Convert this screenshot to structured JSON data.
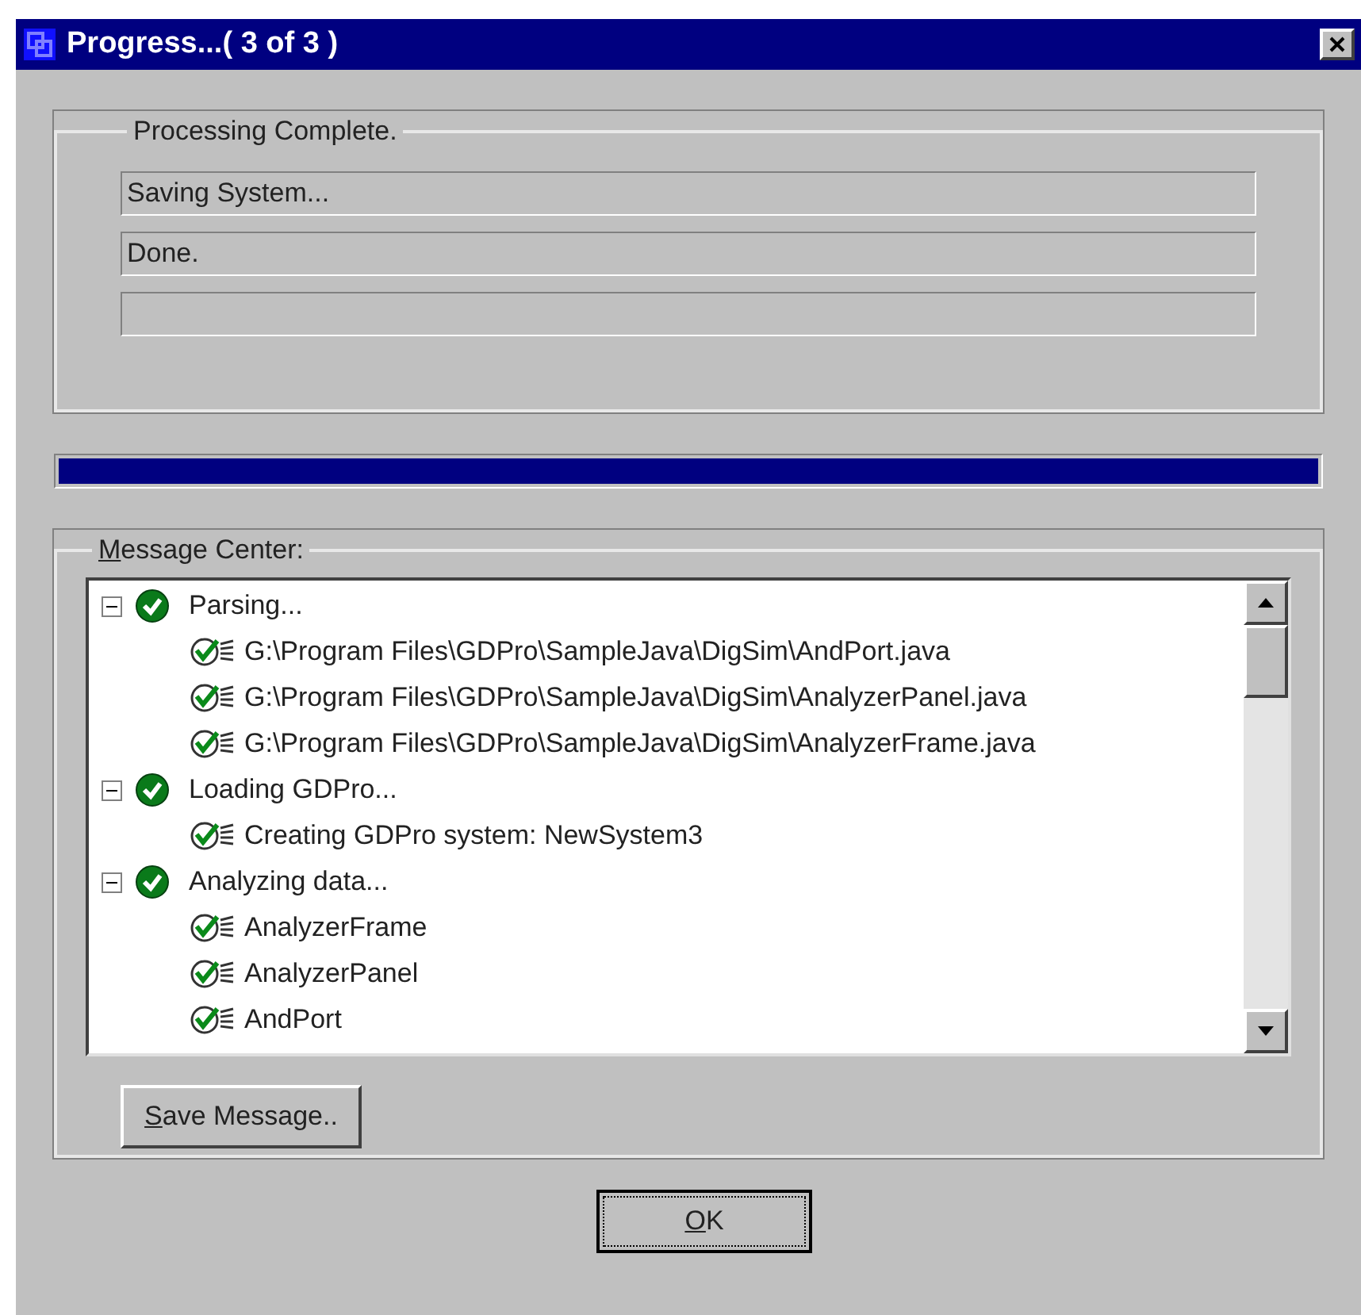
{
  "window": {
    "title": "Progress...( 3 of 3 )"
  },
  "processing": {
    "label": "Processing Complete.",
    "fields": [
      {
        "value": "Saving System..."
      },
      {
        "value": "Done."
      }
    ]
  },
  "progress": {
    "level": 1
  },
  "message_center": {
    "label": "Message Center:",
    "tree": [
      {
        "label": "Parsing...",
        "expanded": true,
        "children": [
          {
            "label": "G:\\Program Files\\GDPro\\SampleJava\\DigSim\\AndPort.java"
          },
          {
            "label": "G:\\Program Files\\GDPro\\SampleJava\\DigSim\\AnalyzerPanel.java"
          },
          {
            "label": "G:\\Program Files\\GDPro\\SampleJava\\DigSim\\AnalyzerFrame.java"
          }
        ]
      },
      {
        "label": "Loading GDPro...",
        "expanded": true,
        "children": [
          {
            "label": "Creating GDPro system: NewSystem3"
          }
        ]
      },
      {
        "label": "Analyzing data...",
        "expanded": true,
        "children": [
          {
            "label": "AnalyzerFrame"
          },
          {
            "label": "AnalyzerPanel"
          },
          {
            "label": "AndPort"
          }
        ]
      }
    ],
    "save_button": "Save Message.."
  },
  "ok_button": "OK"
}
